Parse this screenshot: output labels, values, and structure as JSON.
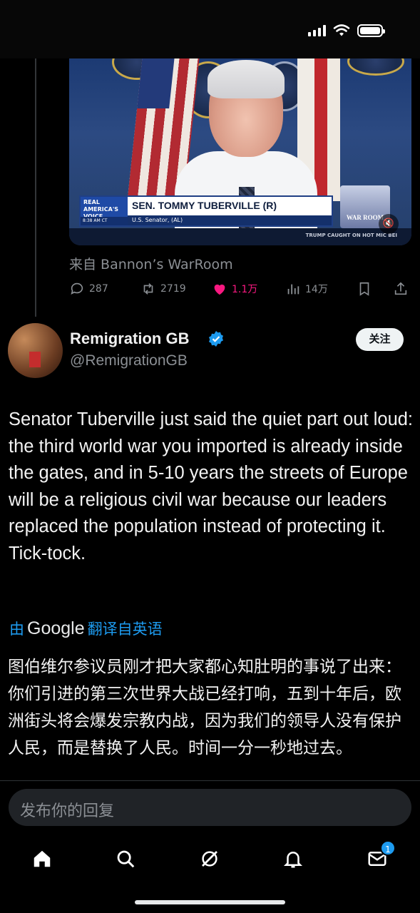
{
  "video": {
    "lower_third_logo": "REAL AMERICA'S VOICE",
    "lower_third_time": "8:38 AM CT",
    "lower_third_name": "SEN. TOMMY TUBERVILLE (R)",
    "lower_third_title": "U.S. Senator, (AL)",
    "brand": "WAR ROOM",
    "ticker": "TRUMP CAUGHT ON HOT MIC BEI"
  },
  "quoted": {
    "source": "来自 Bannon’s WarRoom",
    "replies": "287",
    "retweets": "2719",
    "likes": "1.1万",
    "views": "14万"
  },
  "author": {
    "name": "Remigration GB",
    "handle": "@RemigrationGB",
    "follow_label": "关注"
  },
  "tweet": {
    "text": "Senator Tuberville just said the quiet part out loud: the third world war you imported is already inside the gates, and in 5-10 years the streets of Europe will be a religious civil war because our leaders replaced the population instead of protecting it. Tick-tock.",
    "translate_prefix": "由",
    "translate_brand": "Google",
    "translate_suffix": "翻译自英语",
    "translated_text": "图伯维尔参议员刚才把大家都心知肚明的事说了出来：你们引进的第三次世界大战已经打响，五到十年后，欧洲街头将会爆发宗教内战，因为我们的领导人没有保护人民，而是替换了人民。时间一分一秒地过去。"
  },
  "reply": {
    "placeholder": "发布你的回复"
  },
  "tabs": {
    "messages_badge": "1"
  },
  "colors": {
    "accent": "#1d9bf0",
    "like": "#f91880",
    "muted": "#8b8f94"
  }
}
